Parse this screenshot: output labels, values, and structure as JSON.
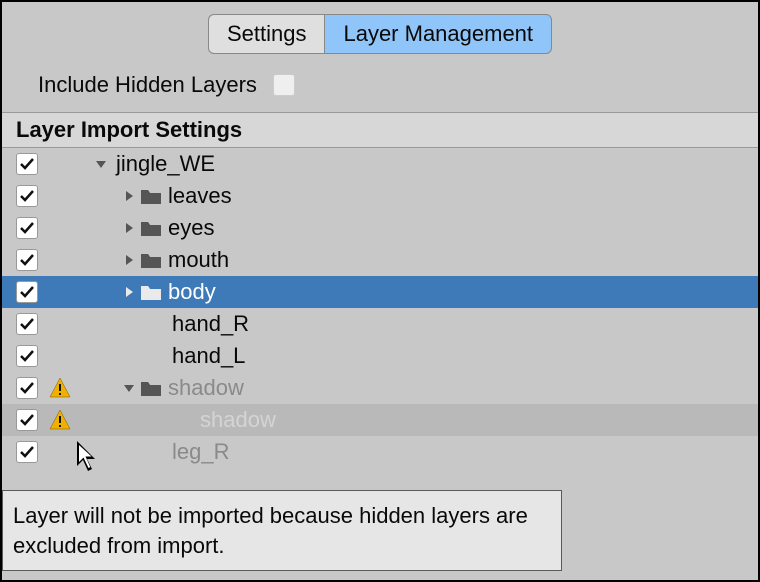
{
  "tabs": {
    "settings": "Settings",
    "layer_management": "Layer Management"
  },
  "include_hidden_label": "Include Hidden Layers",
  "include_hidden_checked": false,
  "section_header": "Layer Import Settings",
  "tree": [
    {
      "label": "jingle_WE",
      "depth": 0,
      "checked": true,
      "warn": false,
      "hasArrow": true,
      "arrowOpen": true,
      "hasFolder": false,
      "selected": false,
      "dim": false,
      "subdim": false
    },
    {
      "label": "leaves",
      "depth": 1,
      "checked": true,
      "warn": false,
      "hasArrow": true,
      "arrowOpen": false,
      "hasFolder": true,
      "selected": false,
      "dim": false,
      "subdim": false
    },
    {
      "label": "eyes",
      "depth": 1,
      "checked": true,
      "warn": false,
      "hasArrow": true,
      "arrowOpen": false,
      "hasFolder": true,
      "selected": false,
      "dim": false,
      "subdim": false
    },
    {
      "label": "mouth",
      "depth": 1,
      "checked": true,
      "warn": false,
      "hasArrow": true,
      "arrowOpen": false,
      "hasFolder": true,
      "selected": false,
      "dim": false,
      "subdim": false
    },
    {
      "label": "body",
      "depth": 1,
      "checked": true,
      "warn": false,
      "hasArrow": true,
      "arrowOpen": false,
      "hasFolder": true,
      "selected": true,
      "dim": false,
      "subdim": false
    },
    {
      "label": "hand_R",
      "depth": 1,
      "checked": true,
      "warn": false,
      "hasArrow": false,
      "arrowOpen": false,
      "hasFolder": false,
      "selected": false,
      "dim": false,
      "subdim": false,
      "leafPad": true
    },
    {
      "label": "hand_L",
      "depth": 1,
      "checked": true,
      "warn": false,
      "hasArrow": false,
      "arrowOpen": false,
      "hasFolder": false,
      "selected": false,
      "dim": false,
      "subdim": false,
      "leafPad": true
    },
    {
      "label": "shadow",
      "depth": 1,
      "checked": true,
      "warn": true,
      "hasArrow": true,
      "arrowOpen": true,
      "hasFolder": true,
      "selected": false,
      "dim": true,
      "subdim": false
    },
    {
      "label": "shadow",
      "depth": 2,
      "checked": true,
      "warn": true,
      "hasArrow": false,
      "arrowOpen": false,
      "hasFolder": false,
      "selected": false,
      "dim": false,
      "subdim": true,
      "leafPad": true
    },
    {
      "label": "leg_R",
      "depth": 1,
      "checked": true,
      "warn": false,
      "hasArrow": false,
      "arrowOpen": false,
      "hasFolder": false,
      "selected": false,
      "dim": true,
      "subdim": false,
      "leafPad": true
    }
  ],
  "tooltip": "Layer will not be imported because hidden layers are excluded from import.",
  "colors": {
    "selected_bg": "#3e7ab8",
    "tab_active_bg": "#8fc5f8",
    "panel_bg": "#c8c8c8"
  },
  "chart_data": null
}
